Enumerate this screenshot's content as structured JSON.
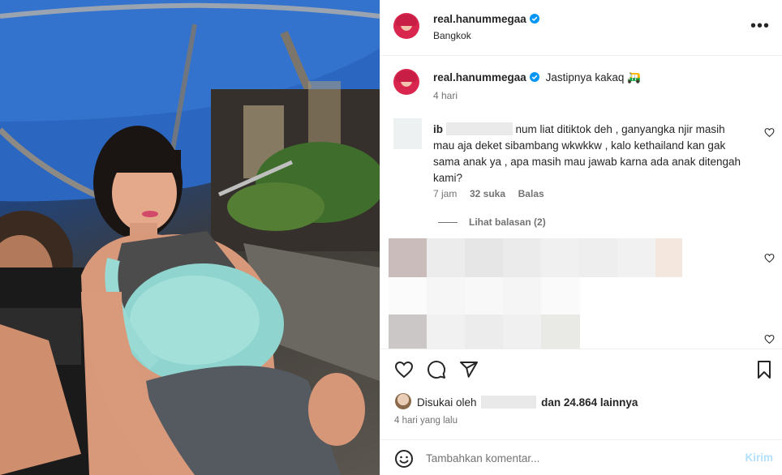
{
  "header": {
    "username": "real.hanummegaa",
    "location": "Bangkok",
    "more_icon": "more-horizontal-icon"
  },
  "caption": {
    "username": "real.hanummegaa",
    "text": "Jastipnya kakaq",
    "emoji": "🛺",
    "time": "4 hari"
  },
  "comments": [
    {
      "username_prefix": "ib",
      "text_line1": "num liat ditiktok deh , ganyangka njir masih",
      "text_line2": "mau aja deket sibambang wkwkkw , kalo kethailand kan gak",
      "text_line3": "sama anak ya , apa masih mau jawab karna ada anak ditengah",
      "text_line4": "kami?",
      "time": "7 jam",
      "likes": "32 suka",
      "reply": "Balas",
      "view_replies": "Lihat balasan (2)"
    }
  ],
  "footer": {
    "liked_by_prefix": "Disukai oleh",
    "liked_by_suffix": "dan 24.864 lainnya",
    "time": "4 hari yang lalu"
  },
  "composer": {
    "placeholder": "Tambahkan komentar...",
    "post_label": "Kirim"
  },
  "colors": {
    "verified": "#0095f6",
    "post_disabled": "#b2dffc",
    "muted": "#737373"
  }
}
